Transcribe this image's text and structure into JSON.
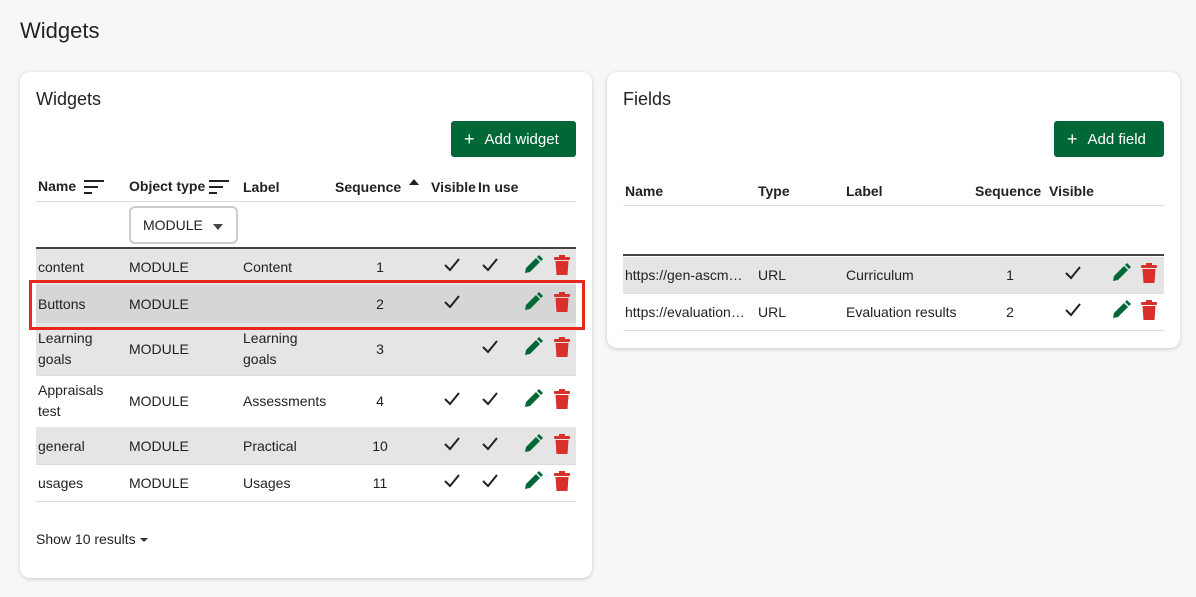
{
  "page": {
    "title": "Widgets"
  },
  "widgets_card": {
    "title": "Widgets",
    "add_button": "Add widget",
    "columns": {
      "name": "Name",
      "object_type": "Object type",
      "label": "Label",
      "sequence": "Sequence",
      "visible": "Visible",
      "in_use": "In use"
    },
    "filter": {
      "object_type_selected": "MODULE"
    },
    "rows": [
      {
        "name": "content",
        "object_type": "MODULE",
        "label": "Content",
        "sequence": "1",
        "visible": true,
        "in_use": true,
        "highlighted": false
      },
      {
        "name": "Buttons",
        "object_type": "MODULE",
        "label": "",
        "sequence": "2",
        "visible": true,
        "in_use": false,
        "highlighted": true
      },
      {
        "name": "Learning goals",
        "object_type": "MODULE",
        "label": "Learning goals",
        "sequence": "3",
        "visible": false,
        "in_use": true,
        "highlighted": false
      },
      {
        "name": "Appraisals test",
        "object_type": "MODULE",
        "label": "Assessments",
        "sequence": "4",
        "visible": true,
        "in_use": true,
        "highlighted": false
      },
      {
        "name": "general",
        "object_type": "MODULE",
        "label": "Practical",
        "sequence": "10",
        "visible": true,
        "in_use": true,
        "highlighted": false
      },
      {
        "name": "usages",
        "object_type": "MODULE",
        "label": "Usages",
        "sequence": "11",
        "visible": true,
        "in_use": true,
        "highlighted": false
      }
    ],
    "show_results": "Show 10 results"
  },
  "fields_card": {
    "title": "Fields",
    "add_button": "Add field",
    "columns": {
      "name": "Name",
      "type": "Type",
      "label": "Label",
      "sequence": "Sequence",
      "visible": "Visible"
    },
    "rows": [
      {
        "name": "https://gen-ascm…",
        "type": "URL",
        "label": "Curriculum",
        "sequence": "1",
        "visible": true
      },
      {
        "name": "https://evaluation…",
        "type": "URL",
        "label": "Evaluation results",
        "sequence": "2",
        "visible": true
      }
    ]
  },
  "colors": {
    "accent": "#006837",
    "delete": "#d9302c",
    "highlight": "#e8281e",
    "row_shade": "#e5e5e5"
  },
  "icons": {
    "add": "plus-icon",
    "edit": "pencil-icon",
    "delete": "trash-icon",
    "sort": "sort-lines-icon",
    "sort_asc": "caret-up-icon",
    "check": "check-icon",
    "dropdown": "caret-down-icon"
  }
}
